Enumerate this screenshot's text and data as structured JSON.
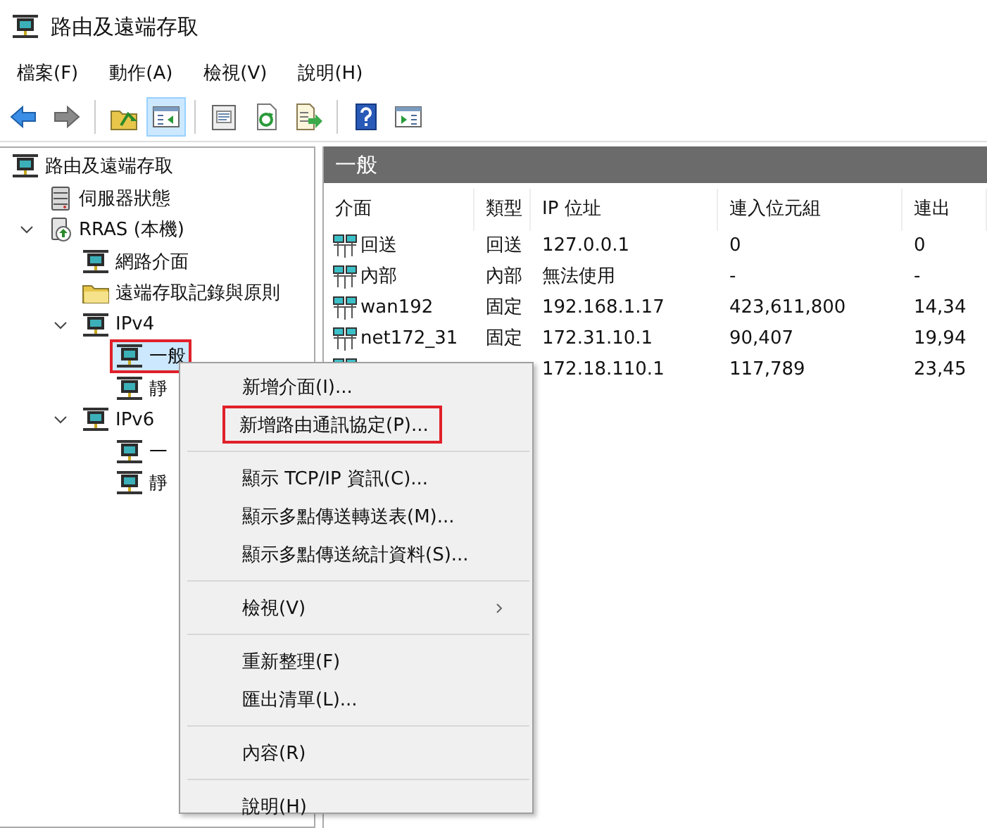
{
  "window": {
    "title": "路由及遠端存取"
  },
  "menu_bar": [
    "檔案(F)",
    "動作(A)",
    "檢視(V)",
    "說明(H)"
  ],
  "toolbar": [
    {
      "kind": "back",
      "pressed": false
    },
    {
      "kind": "forward",
      "pressed": false
    },
    {
      "kind": "sep"
    },
    {
      "kind": "up",
      "pressed": false
    },
    {
      "kind": "tree",
      "pressed": true
    },
    {
      "kind": "sep"
    },
    {
      "kind": "properties",
      "pressed": false
    },
    {
      "kind": "refresh",
      "pressed": false
    },
    {
      "kind": "export",
      "pressed": false
    },
    {
      "kind": "sep"
    },
    {
      "kind": "help",
      "pressed": false
    },
    {
      "kind": "action",
      "pressed": false
    }
  ],
  "tree": [
    {
      "label": "路由及遠端存取",
      "kind": "node",
      "selected": false,
      "highlighted": false,
      "children": [
        {
          "label": "伺服器狀態",
          "kind": "server",
          "selected": false,
          "highlighted": false
        },
        {
          "label": "RRAS (本機)",
          "kind": "machine",
          "expanded": true,
          "selected": false,
          "highlighted": false,
          "children": [
            {
              "label": "網路介面",
              "kind": "node",
              "selected": false,
              "highlighted": false
            },
            {
              "label": "遠端存取記錄與原則",
              "kind": "folder",
              "selected": false,
              "highlighted": false
            },
            {
              "label": "IPv4",
              "kind": "node",
              "expanded": true,
              "selected": false,
              "highlighted": false,
              "children": [
                {
                  "label": "一般",
                  "kind": "node",
                  "selected": true,
                  "highlighted": true
                },
                {
                  "label": "靜",
                  "kind": "node",
                  "selected": false,
                  "highlighted": false
                }
              ]
            },
            {
              "label": "IPv6",
              "kind": "node",
              "expanded": true,
              "selected": false,
              "highlighted": false,
              "children": [
                {
                  "label": "一",
                  "kind": "node",
                  "selected": false,
                  "highlighted": false
                },
                {
                  "label": "靜",
                  "kind": "node",
                  "selected": false,
                  "highlighted": false
                }
              ]
            }
          ]
        }
      ]
    }
  ],
  "details": {
    "title": "一般",
    "columns": [
      "介面",
      "類型",
      "IP 位址",
      "連入位元組",
      "連出"
    ],
    "rows": [
      [
        "回送",
        "回送",
        "127.0.0.1",
        "0",
        "0"
      ],
      [
        "內部",
        "內部",
        "無法使用",
        "-",
        "-"
      ],
      [
        "wan192",
        "固定",
        "192.168.1.17",
        "423,611,800",
        "14,34"
      ],
      [
        "net172_31",
        "固定",
        "172.31.10.1",
        "90,407",
        "19,94"
      ],
      [
        null,
        null,
        "172.18.110.1",
        "117,789",
        "23,45"
      ]
    ]
  },
  "context_menu": [
    {
      "kind": "item",
      "label": "新增介面(I)...",
      "highlighted": false
    },
    {
      "kind": "item",
      "label": "新增路由通訊協定(P)...",
      "highlighted": true
    },
    {
      "kind": "separator"
    },
    {
      "kind": "item",
      "label": "顯示 TCP/IP 資訊(C)...",
      "highlighted": false
    },
    {
      "kind": "item",
      "label": "顯示多點傳送轉送表(M)...",
      "highlighted": false
    },
    {
      "kind": "item",
      "label": "顯示多點傳送統計資料(S)...",
      "highlighted": false
    },
    {
      "kind": "separator"
    },
    {
      "kind": "submenu",
      "label": "檢視(V)",
      "highlighted": false
    },
    {
      "kind": "separator"
    },
    {
      "kind": "item",
      "label": "重新整理(F)",
      "highlighted": false
    },
    {
      "kind": "item",
      "label": "匯出清單(L)...",
      "highlighted": false
    },
    {
      "kind": "separator"
    },
    {
      "kind": "item",
      "label": "內容(R)",
      "highlighted": false
    },
    {
      "kind": "separator"
    },
    {
      "kind": "item",
      "label": "說明(H)",
      "highlighted": false
    }
  ]
}
